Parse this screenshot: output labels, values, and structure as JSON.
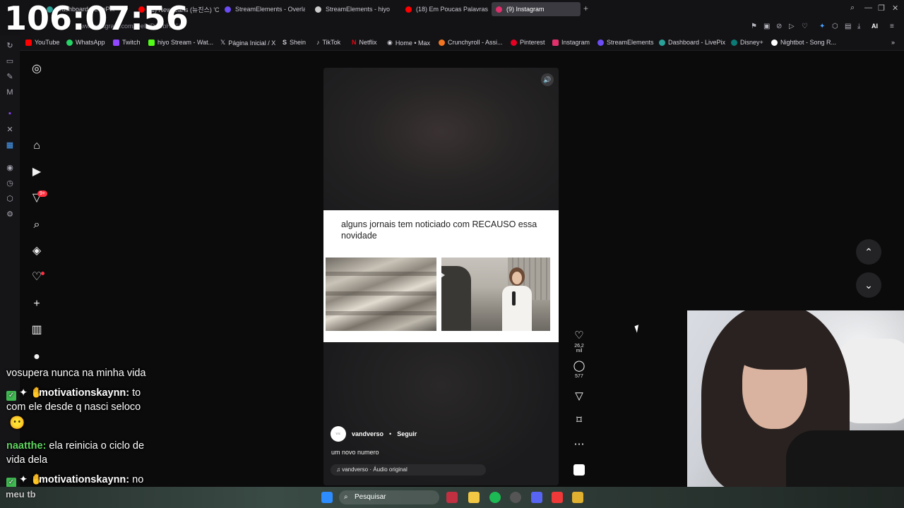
{
  "clock": {
    "time": "106:07:56"
  },
  "tabs": [
    {
      "label": "Dashboard - LivePix",
      "color": "#2aa198"
    },
    {
      "label": "(1) NewJeans (뉴진스) 'C",
      "color": "#ff0000"
    },
    {
      "label": "StreamElements - Overlay",
      "color": "#6c4cf5"
    },
    {
      "label": "StreamElements - hiyo",
      "color": "#cccccc"
    },
    {
      "label": "(18) Em Poucas Palavras",
      "color": "#ff0000"
    },
    {
      "label": "(9) Instagram",
      "color": "#e1306c"
    }
  ],
  "address": {
    "url": "www.instagram.com/reels/DJRbH-Yi/"
  },
  "bookmarks": [
    {
      "label": "YouTube",
      "color": "#ff0000"
    },
    {
      "label": "WhatsApp",
      "color": "#25d366"
    },
    {
      "label": "Twitch",
      "color": "#9146ff"
    },
    {
      "label": "hiyo Stream - Wat...",
      "color": "#53fc18"
    },
    {
      "label": "Página Inicial / X",
      "color": "#ffffff"
    },
    {
      "label": "Shein",
      "color": "#ffffff"
    },
    {
      "label": "TikTok",
      "color": "#ffffff"
    },
    {
      "label": "Netflix",
      "color": "#e50914"
    },
    {
      "label": "Home • Max",
      "color": "#ffffff"
    },
    {
      "label": "Crunchyroll - Assi...",
      "color": "#f47521"
    },
    {
      "label": "Pinterest",
      "color": "#e60023"
    },
    {
      "label": "Instagram",
      "color": "#e1306c"
    },
    {
      "label": "StreamElements",
      "color": "#6c4cf5"
    },
    {
      "label": "Dashboard - LivePix",
      "color": "#2aa198"
    },
    {
      "label": "Disney+",
      "color": "#0b7a75"
    },
    {
      "label": "Nightbot - Song R...",
      "color": "#ffffff"
    }
  ],
  "toolbar": {
    "ai_label": "AI"
  },
  "instagram": {
    "notif_badge": "9+",
    "reel": {
      "card_text": "alguns jornais tem noticiado com RECAUSO essa novidade",
      "author": "vandverso",
      "separator": "•",
      "follow": "Seguir",
      "caption": "um novo numero",
      "audio": "♫ vandverso · Áudio original",
      "avatar_text": "v.v."
    },
    "likes": "26,2 mil",
    "comments": "577"
  },
  "chat": [
    {
      "user": "",
      "text": "vosupera nunca na minha vida"
    },
    {
      "user": "motivationskaynn:",
      "text": " to"
    },
    {
      "user": "",
      "text": "com ele desde q nasci seloco"
    },
    {
      "user": "naatthe:",
      "text": " ela reinicia o ciclo de"
    },
    {
      "user": "",
      "text": "vida dela"
    },
    {
      "user": "motivationskaynn:",
      "text": " no"
    }
  ],
  "overlay": {
    "meu_tb": "meu tb"
  },
  "taskbar": {
    "search_placeholder": "Pesquisar"
  }
}
